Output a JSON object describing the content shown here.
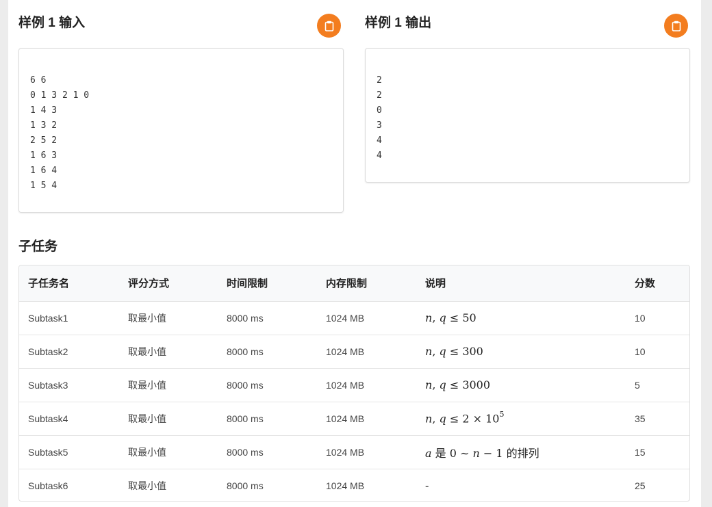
{
  "samples": {
    "input": {
      "title": "样例 1 输入",
      "content": "6 6\n0 1 3 2 1 0\n1 4 3\n1 3 2\n2 5 2\n1 6 3\n1 6 4\n1 5 4"
    },
    "output": {
      "title": "样例 1 输出",
      "content": "2\n2\n0\n3\n4\n4"
    },
    "copy_icon": "clipboard-icon",
    "accent_color": "#f37d1f"
  },
  "subtasks": {
    "title": "子任务",
    "headers": [
      "子任务名",
      "评分方式",
      "时间限制",
      "内存限制",
      "说明",
      "分数"
    ],
    "rows": [
      {
        "name": "Subtask1",
        "scoring": "取最小值",
        "time": "8000 ms",
        "memory": "1024 MB",
        "note": "n, q ≤ 50",
        "score": "10"
      },
      {
        "name": "Subtask2",
        "scoring": "取最小值",
        "time": "8000 ms",
        "memory": "1024 MB",
        "note": "n, q ≤ 300",
        "score": "10"
      },
      {
        "name": "Subtask3",
        "scoring": "取最小值",
        "time": "8000 ms",
        "memory": "1024 MB",
        "note": "n, q ≤ 3000",
        "score": "5"
      },
      {
        "name": "Subtask4",
        "scoring": "取最小值",
        "time": "8000 ms",
        "memory": "1024 MB",
        "note": "n, q ≤ 2 × 10^5",
        "score": "35"
      },
      {
        "name": "Subtask5",
        "scoring": "取最小值",
        "time": "8000 ms",
        "memory": "1024 MB",
        "note": "a 是 0 ∼ n − 1 的排列",
        "score": "15"
      },
      {
        "name": "Subtask6",
        "scoring": "取最小值",
        "time": "8000 ms",
        "memory": "1024 MB",
        "note": "-",
        "score": "25"
      }
    ]
  }
}
